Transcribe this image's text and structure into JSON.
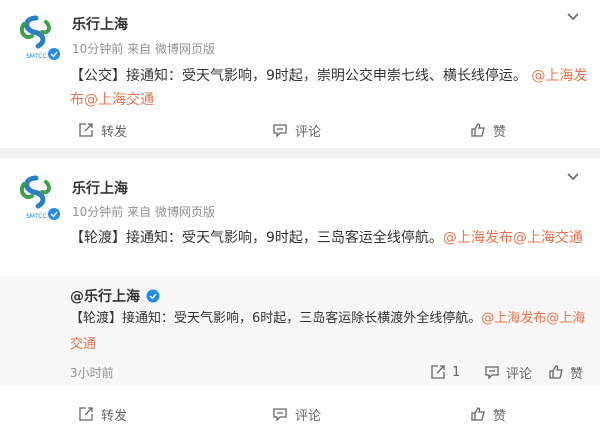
{
  "posts": [
    {
      "author": "乐行上海",
      "time": "10分钟前",
      "via_prefix": "来自",
      "via": "微博网页版",
      "text_plain": "【公交】接通知：受天气影响，9时起，崇明公交申崇七线、横长线停运。",
      "mention1": "@上海发布",
      "mention2": "@上海交通",
      "actions": {
        "repost": "转发",
        "comment": "评论",
        "like": "赞"
      }
    },
    {
      "author": "乐行上海",
      "time": "10分钟前",
      "via_prefix": "来自",
      "via": "微博网页版",
      "text_plain": "【轮渡】接通知：受天气影响，9时起，三岛客运全线停航。",
      "mention1": "@上海发布",
      "mention2": "@上海交通",
      "actions": {
        "repost": "转发",
        "comment": "评论",
        "like": "赞"
      },
      "quoted": {
        "author": "@乐行上海",
        "text_plain": "【轮渡】接通知：受天气影响，6时起，三岛客运除长横渡外全线停航。",
        "mention1": "@上海发布",
        "mention2": "@上海交通",
        "time": "3小时前",
        "repost_count": "1",
        "comment": "评论",
        "like": "赞"
      }
    }
  ],
  "avatar_text": "SMTCC",
  "colors": {
    "link": "#eb7350",
    "verified": "#1e8ce6",
    "logo_green": "#3aa04a",
    "logo_blue": "#2b7fc8"
  }
}
